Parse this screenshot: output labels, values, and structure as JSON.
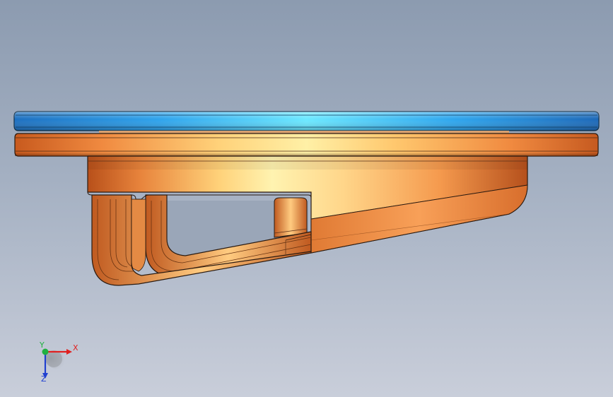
{
  "viewport": {
    "background_top": "#8C9BB0",
    "background_bottom": "#C8CDD9",
    "part_colors": {
      "blue_plate": "#2A9FE6",
      "orange_body": "#F09A55",
      "edge": "#2A1A10"
    }
  },
  "triad": {
    "x_label": "X",
    "y_label": "Y",
    "z_label": "Z",
    "x_color": "#E02020",
    "y_color": "#20B040",
    "z_color": "#2040D0"
  }
}
